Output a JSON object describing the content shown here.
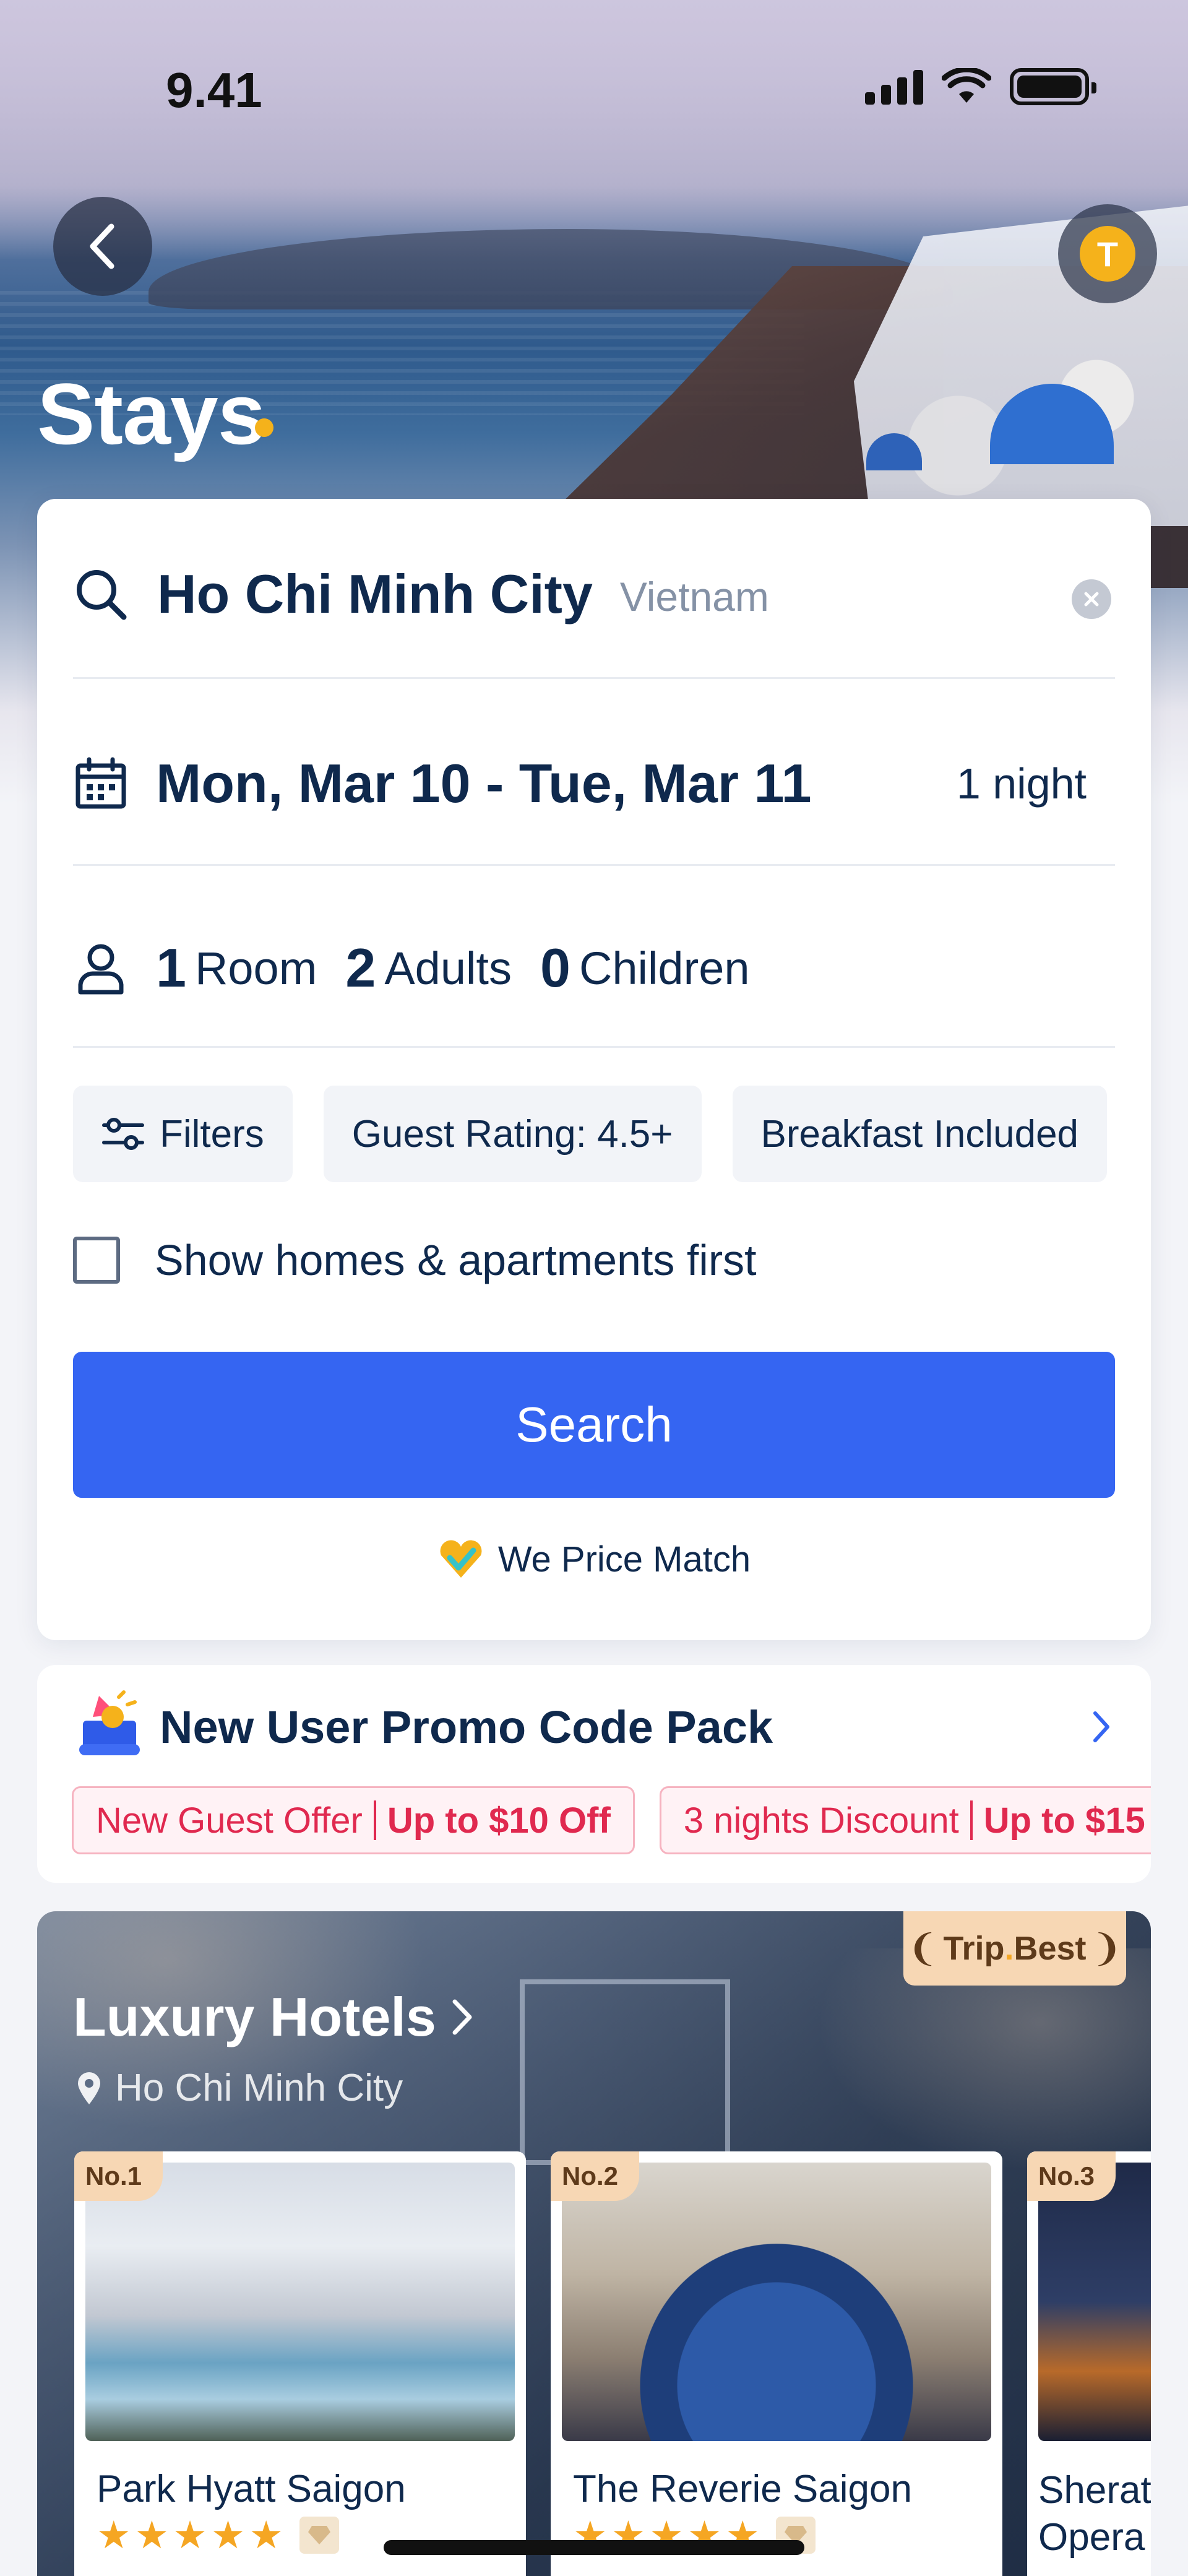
{
  "status_bar": {
    "time": "9.41"
  },
  "header": {
    "title": "Stays"
  },
  "search": {
    "destination": "Ho Chi Minh City",
    "country": "Vietnam",
    "dates": "Mon, Mar 10 - Tue, Mar 11",
    "nights": "1 night",
    "rooms_num": "1",
    "rooms_label": "Room",
    "adults_num": "2",
    "adults_label": "Adults",
    "children_num": "0",
    "children_label": "Children",
    "chips": [
      "Filters",
      "Guest Rating: 4.5+",
      "Breakfast Included"
    ],
    "homes_first_label": "Show homes & apartments first",
    "homes_first_checked": false,
    "search_button": "Search",
    "price_match": "We Price Match"
  },
  "promo": {
    "title": "New User Promo Code Pack",
    "coupons": [
      {
        "label": "New Guest  Offer",
        "value": "Up to $10 Off"
      },
      {
        "label": "3 nights Discount",
        "value": "Up to $15"
      }
    ]
  },
  "luxury": {
    "badge_left": "Trip",
    "badge_right": "Best",
    "title": "Luxury Hotels",
    "city": "Ho Chi Minh City",
    "hotels": [
      {
        "rank": "No.1",
        "name": "Park Hyatt Saigon",
        "stars": 5
      },
      {
        "rank": "No.2",
        "name": "The Reverie Saigon",
        "stars": 5
      },
      {
        "rank": "No.3",
        "name_line1": "Sherat",
        "name_line2": "Opera"
      }
    ]
  },
  "user": {
    "avatar_initial": "T"
  },
  "colors": {
    "accent": "#3565f2",
    "brand_yellow": "#f5b21b",
    "promo_red": "#e0294f",
    "text": "#0f294d"
  }
}
